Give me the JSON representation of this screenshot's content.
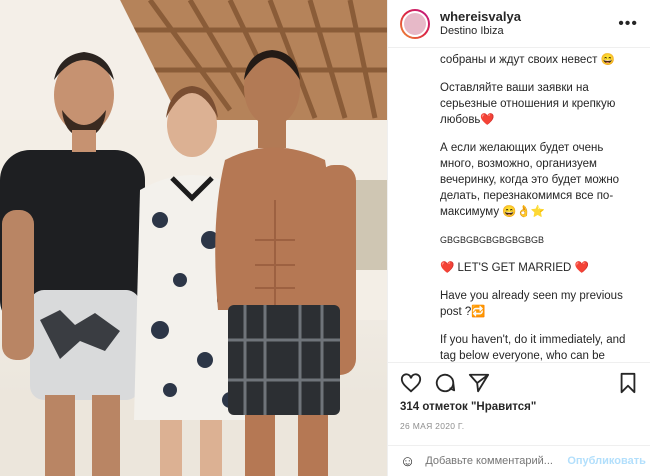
{
  "header": {
    "username": "whereisvalya",
    "location": "Destino Ibiza",
    "more_icon": "more-horizontal-icon"
  },
  "caption": {
    "lines": [
      "собраны и ждут своих невест 😄",
      "Оставляйте ваши заявки на серьезные отношения и крепкую любовь❤️",
      "А если желающих будет очень много, возможно, организуем вечеринку, когда это будет можно делать, перезнакомимся все по-максимуму 😄👌⭐",
      "GBGBGBGBGBGBGBGB",
      "❤️ LET'S GET MARRIED ❤️",
      "Have you already seen my previous post ?🔁",
      "If you haven't, do it immediately, and tag below everyone, who can be"
    ]
  },
  "actions": {
    "like_icon": "heart-icon",
    "comment_icon": "comment-icon",
    "share_icon": "share-icon",
    "save_icon": "bookmark-icon"
  },
  "likes_text": "314 отметок \"Нравится\"",
  "date_text": "26 мая 2020 г.",
  "comment_box": {
    "emoji_icon": "smile-icon",
    "placeholder": "Добавьте комментарий...",
    "post_label": "Опубликовать"
  },
  "photo": {
    "description_icon": "photo-of-three-people"
  }
}
